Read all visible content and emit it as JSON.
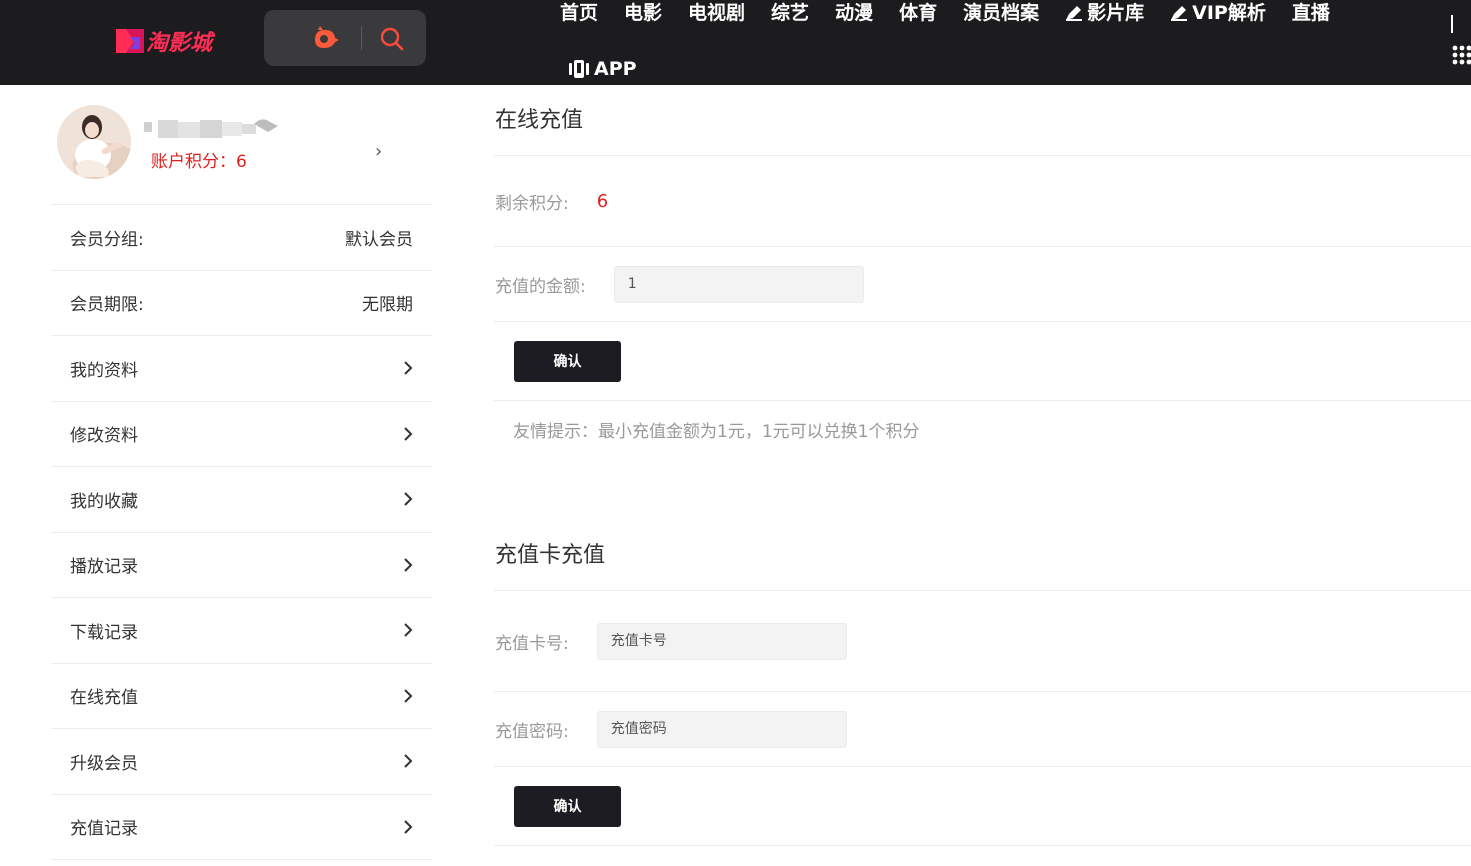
{
  "header": {
    "logo_text": "淘影城",
    "nav": [
      {
        "label": "首页"
      },
      {
        "label": "电影"
      },
      {
        "label": "电视剧"
      },
      {
        "label": "综艺"
      },
      {
        "label": "动漫"
      },
      {
        "label": "体育"
      },
      {
        "label": "演员档案"
      },
      {
        "label": "影片库",
        "icon": "pen-icon"
      },
      {
        "label": "VIP解析",
        "icon": "pen-icon"
      },
      {
        "label": "直播"
      }
    ],
    "nav_app": {
      "label": "APP",
      "icon": "phone-icon"
    }
  },
  "colors": {
    "header_bg": "#1c1c1e",
    "accent_red": "#e02020",
    "button_bg": "#1c1c22"
  },
  "sidebar": {
    "points_label": "账户积分：",
    "points_value": "6",
    "member_group": {
      "label": "会员分组:",
      "value": "默认会员"
    },
    "member_term": {
      "label": "会员期限:",
      "value": "无限期"
    },
    "links": [
      {
        "label": "我的资料"
      },
      {
        "label": "修改资料"
      },
      {
        "label": "我的收藏"
      },
      {
        "label": "播放记录"
      },
      {
        "label": "下载记录"
      },
      {
        "label": "在线充值"
      },
      {
        "label": "升级会员"
      },
      {
        "label": "充值记录"
      }
    ]
  },
  "online_recharge": {
    "title": "在线充值",
    "remaining_label": "剩余积分:",
    "remaining_value": "6",
    "amount_label": "充值的金额:",
    "amount_value": "1",
    "confirm_label": "确认",
    "tip": "友情提示：最小充值金额为1元，1元可以兑换1个积分"
  },
  "card_recharge": {
    "title": "充值卡充值",
    "card_no_label": "充值卡号:",
    "card_no_placeholder": "充值卡号",
    "card_pwd_label": "充值密码:",
    "card_pwd_placeholder": "充值密码",
    "confirm_label": "确认"
  }
}
